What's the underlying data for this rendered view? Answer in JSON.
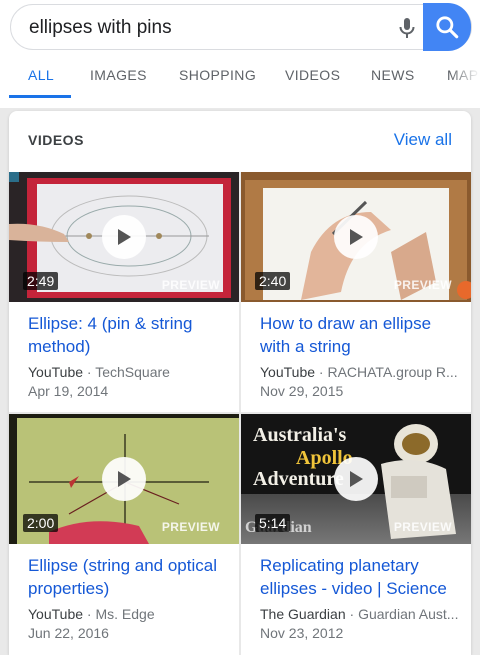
{
  "search": {
    "query": "ellipses with pins"
  },
  "tabs": [
    {
      "label": "ALL",
      "active": true
    },
    {
      "label": "IMAGES"
    },
    {
      "label": "SHOPPING"
    },
    {
      "label": "VIDEOS"
    },
    {
      "label": "NEWS"
    },
    {
      "label": "MAP"
    }
  ],
  "videos_card": {
    "title": "VIDEOS",
    "view_all": "View all",
    "preview_label": "PREVIEW",
    "items": [
      {
        "duration": "2:49",
        "title": "Ellipse: 4 (pin & string method)",
        "source": "YouTube",
        "channel": "TechSquare",
        "date": "Apr 19, 2014"
      },
      {
        "duration": "2:40",
        "title": "How to draw an ellipse with a string",
        "source": "YouTube",
        "channel": "RACHATA.group R...",
        "date": "Nov 29, 2015"
      },
      {
        "duration": "2:00",
        "title": "Ellipse (string and optical properties)",
        "source": "YouTube",
        "channel": "Ms. Edge",
        "date": "Jun 22, 2016"
      },
      {
        "duration": "5:14",
        "title": "Replicating planetary ellipses - video | Science",
        "source": "The Guardian",
        "channel": "Guardian Aust...",
        "date": "Nov 23, 2012",
        "thumb_text": [
          "Australia's",
          "Apollo",
          "Adventure",
          "Guardian"
        ]
      }
    ]
  },
  "colors": {
    "accent": "#1a73e8",
    "search_button": "#4285f4"
  }
}
